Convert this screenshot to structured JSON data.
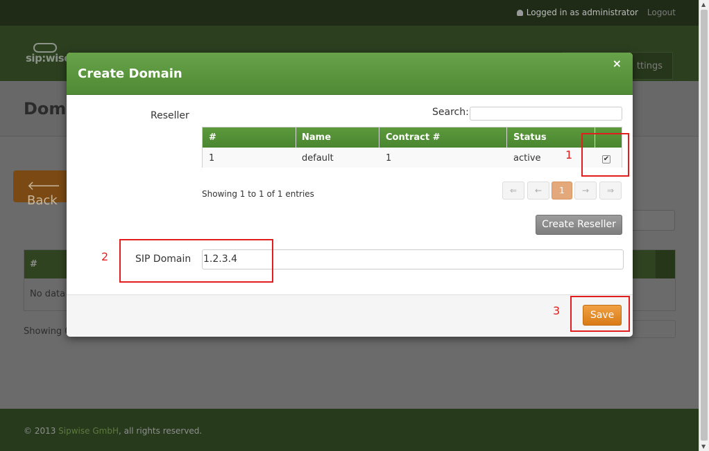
{
  "topbar": {
    "logged_in": "Logged in as administrator",
    "logout": "Logout"
  },
  "header": {
    "logo_text": "sip:wise",
    "nav_settings": "ttings"
  },
  "background": {
    "page_title": "Doma",
    "back_button": "Back",
    "table_hash": "#",
    "no_data": "No data a",
    "showing": "Showing 0"
  },
  "modal": {
    "title": "Create Domain",
    "close": "×",
    "reseller_label": "Reseller",
    "search_label": "Search:",
    "search_value": "",
    "table": {
      "headers": [
        "#",
        "Name",
        "Contract #",
        "Status"
      ],
      "rows": [
        {
          "id": "1",
          "name": "default",
          "contract": "1",
          "status": "active",
          "selected": true
        }
      ]
    },
    "showing": "Showing 1 to 1 of 1 entries",
    "pager": [
      "⇐",
      "←",
      "1",
      "→",
      "⇒"
    ],
    "create_reseller": "Create Reseller",
    "sip_label": "SIP Domain",
    "sip_value": "1.2.3.4",
    "save": "Save"
  },
  "annotations": [
    "1",
    "2",
    "3"
  ],
  "footer": {
    "copyright": "© 2013 ",
    "company": "Sipwise GmbH",
    "rights": ", all rights reserved."
  },
  "colors": {
    "modal_header": "#5b9a3d",
    "save": "#e48a25",
    "annotation": "#e21d1d",
    "pager_active": "#e3a97a"
  }
}
